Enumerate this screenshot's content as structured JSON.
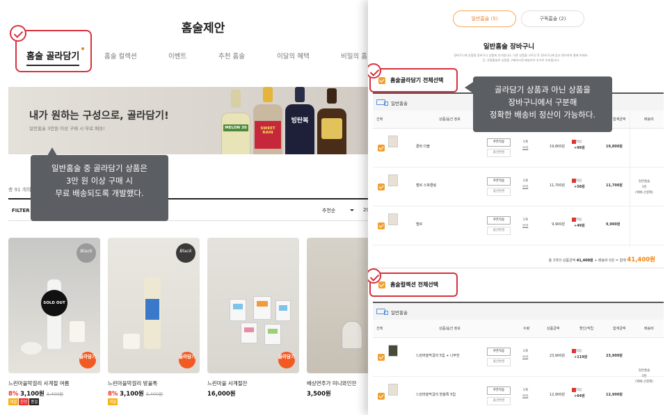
{
  "left": {
    "page_title": "홈술제안",
    "tabs": [
      "홈술 골라담기",
      "홈술 컬렉션",
      "이벤트",
      "추천 홈술",
      "이달의 혜택",
      "비밀의 홈"
    ],
    "banner": {
      "title": "내가 원하는 구성으로, 골라담기!",
      "subtitle": "일반홈술 3만원 이상 구매 시 무료 배송!",
      "bottle_labels": [
        "MELON 30",
        "SWEET RAIN",
        "빙탄복",
        ""
      ]
    },
    "tooltip_lines": [
      "일반홈술 중 골라담기 상품은",
      "3만 원 이상 구매 시",
      "무료 배송되도록 개발했다."
    ],
    "count_text": "총 91 개의",
    "filter_label": "FILTER",
    "sort_label": "추천순",
    "per_page": "20",
    "products": [
      {
        "name": "느린마을막걸리 사계절 여름",
        "discount": "8%",
        "price": "3,100원",
        "old_price": "3,400원",
        "badge": "Black",
        "soldout": "SOLD OUT",
        "collect": "골라담기",
        "tags": [
          "계절",
          "한정",
          "품절"
        ]
      },
      {
        "name": "느린마을막걸리 방울톡",
        "discount": "8%",
        "price": "3,100원",
        "old_price": "3,400원",
        "badge": "Black",
        "soldout": "",
        "collect": "골라담기",
        "tags": [
          "계절"
        ]
      },
      {
        "name": "느린마을 사계절잔",
        "discount": "",
        "price": "16,000원",
        "old_price": "",
        "badge": "",
        "soldout": "",
        "collect": "골라담기",
        "tags": []
      },
      {
        "name": "배상면주가 미니와인잔",
        "discount": "",
        "price": "3,500원",
        "old_price": "",
        "badge": "",
        "soldout": "",
        "collect": "",
        "tags": []
      }
    ]
  },
  "right": {
    "tabs": [
      "일반홈술 (5)",
      "구독홈술 (2)"
    ],
    "cart_title": "일반홈술 장바구니",
    "notes": [
      "장바구니에 상품을 장바구니 상품에 추가합니다. 다른 상품을 고르신 후 장바구니에 담고 편리하게 결제 하세요.",
      "단, 유통홈술로 상품을 구매하시면 배송비가 추가로 부과됩니다."
    ],
    "tooltip_lines": [
      "골라담기 상품과 아닌 상품을",
      "장바구니에서 구분해",
      "정확한 배송비 정산이 가능하다."
    ],
    "section1": {
      "select_all": "홈술골라담기 전체선택",
      "delivery": "일반홈술",
      "columns": [
        "선택",
        "상품/옵션 정보",
        "수량",
        "상품금액",
        "할인/적립",
        "합계금액",
        "배송비"
      ],
      "rows": [
        {
          "name": "클락 더블",
          "qty": "1개",
          "price": "19,800원",
          "points": "+99원",
          "sum": "19,800원"
        },
        {
          "name": "벨르 스파클링",
          "qty": "1개",
          "price": "11,700원",
          "points": "+58원",
          "sum": "11,700원"
        },
        {
          "name": "벨르",
          "qty": "1개",
          "price": "9,900원",
          "points": "+49원",
          "sum": "9,900원"
        }
      ],
      "ship_fee": [
        "일반홈술",
        "3천",
        "(택배-선결제)"
      ],
      "total": {
        "prefix": "총 3개의 상품금액",
        "goods": "41,400원",
        "ship": "+ 배송비 0원",
        "eq": "= 합계",
        "sum": "41,400원"
      }
    },
    "section2": {
      "select_all": "홈술컬렉션 전체선택",
      "delivery": "일반홈술",
      "columns": [
        "선택",
        "상품/옵션 정보",
        "수량",
        "상품금액",
        "할인/적립",
        "합계금액",
        "배송비"
      ],
      "rows": [
        {
          "name": "느린마을막걸리 5입 + 나무잔",
          "qty": "1개",
          "price": "23,900원",
          "points": "+119원",
          "sum": "23,900원"
        },
        {
          "name": "느린마을막걸리 방울톡 5입",
          "qty": "1개",
          "price": "12,900원",
          "points": "+64원",
          "sum": "12,900원"
        }
      ],
      "ship_fee": [
        "일반홈술",
        "3천",
        "(택배-선결제)"
      ]
    },
    "row_buttons": {
      "coupon": "쿠폰적용",
      "option": "옵션변경",
      "change": "변경",
      "point_label": "적립",
      "point_prefix": "적립"
    }
  },
  "colors": {
    "accent": "#f0820f",
    "highlight": "#d7303b",
    "tooltip": "#5b5e63",
    "check": "#f0a030"
  }
}
